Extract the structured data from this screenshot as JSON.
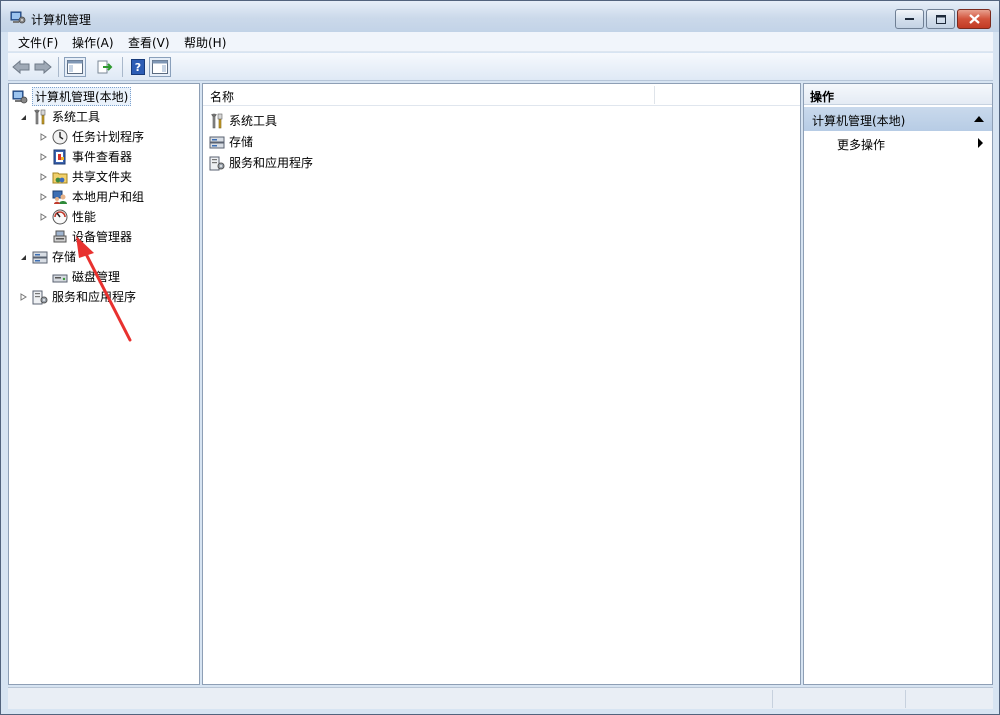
{
  "window": {
    "title": "计算机管理"
  },
  "menu": {
    "items": [
      {
        "label": "文件(F)"
      },
      {
        "label": "操作(A)"
      },
      {
        "label": "查看(V)"
      },
      {
        "label": "帮助(H)"
      }
    ]
  },
  "toolbar": {
    "buttons": [
      "back-icon",
      "forward-icon",
      "show-hide-console-tree-icon",
      "export-list-icon",
      "help-icon",
      "show-hide-action-pane-icon"
    ]
  },
  "tree": {
    "root": {
      "label": "计算机管理(本地)"
    },
    "system_tools": {
      "label": "系统工具",
      "children": [
        {
          "label": "任务计划程序"
        },
        {
          "label": "事件查看器"
        },
        {
          "label": "共享文件夹"
        },
        {
          "label": "本地用户和组"
        },
        {
          "label": "性能"
        },
        {
          "label": "设备管理器"
        }
      ]
    },
    "storage": {
      "label": "存储",
      "children": [
        {
          "label": "磁盘管理"
        }
      ]
    },
    "services": {
      "label": "服务和应用程序"
    }
  },
  "list": {
    "column_name": "名称",
    "items": [
      {
        "label": "系统工具"
      },
      {
        "label": "存储"
      },
      {
        "label": "服务和应用程序"
      }
    ]
  },
  "actions": {
    "header": "操作",
    "group_label": "计算机管理(本地)",
    "more_label": "更多操作"
  },
  "colors": {
    "window_frame": "#d7e4f2",
    "annotation_arrow": "#e8312f",
    "selection_blue": "#b7cce5"
  }
}
